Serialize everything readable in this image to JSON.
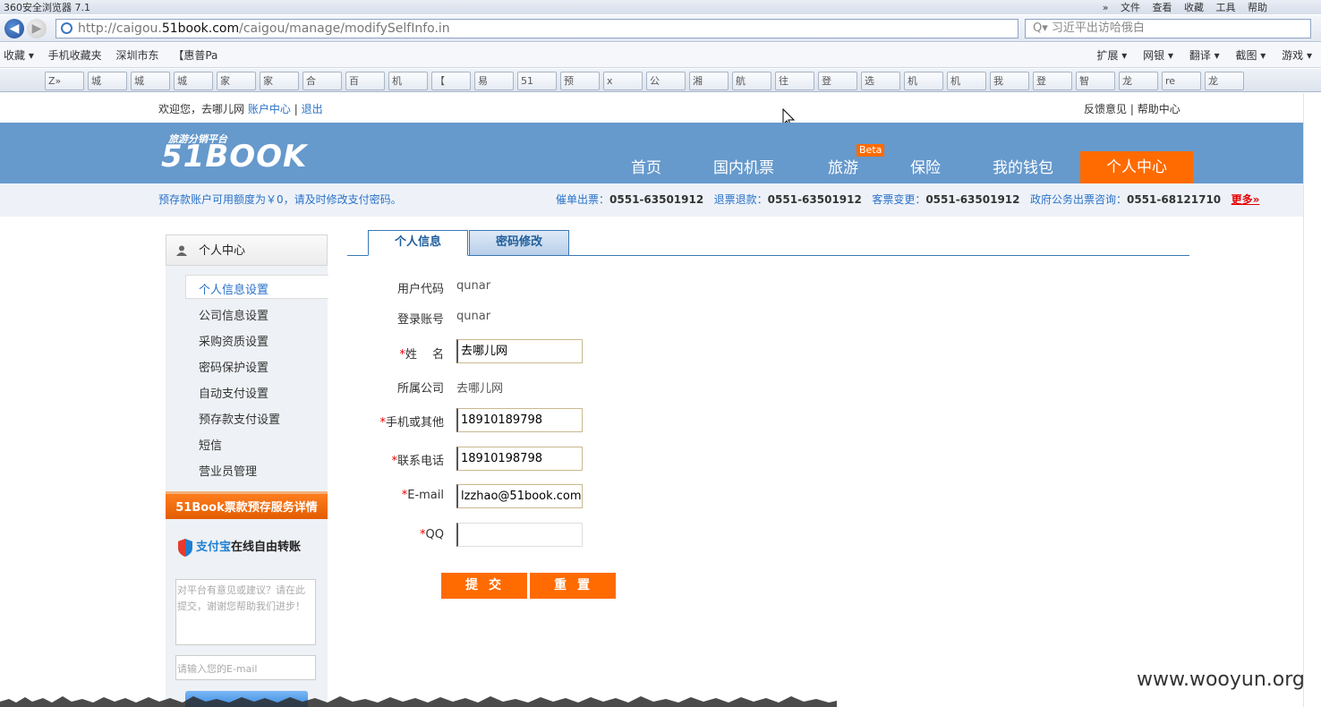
{
  "browser": {
    "title": "360安全浏览器 7.1",
    "menu": [
      "»",
      "文件",
      "查看",
      "收藏",
      "工具",
      "帮助"
    ],
    "url_prefix": "http://caigou.",
    "url_domain": "51book.com",
    "url_path": "/caigou/manage/modifySelfInfo.in",
    "search_text": "习近平出访哈俄白",
    "favorites_left": [
      "收藏 ▾",
      "手机收藏夹",
      "深圳市东",
      "【惠普Pa"
    ],
    "favorites_right": [
      "扩展 ▾",
      "网银 ▾",
      "翻译 ▾",
      "截图 ▾",
      "游戏 ▾"
    ],
    "tabs": [
      "Z»",
      "城",
      "城",
      "城",
      "家",
      "家",
      "合",
      "百",
      "机",
      "【",
      "易",
      "51",
      "预",
      "x",
      "公",
      "湘",
      "航",
      "往",
      "登",
      "选",
      "机",
      "机",
      "我",
      "登",
      "智",
      "龙",
      "re",
      "龙"
    ]
  },
  "topbar": {
    "welcome": "欢迎您，去哪儿网",
    "account_center": "账户中心",
    "separator": "|",
    "logout": "退出",
    "feedback": "反馈意见",
    "help": "帮助中心"
  },
  "header": {
    "logo_small": "旅游分销平台",
    "logo_big": "51BOOK",
    "beta": "Beta",
    "nav": [
      "首页",
      "国内机票",
      "旅游",
      "保险",
      "我的钱包"
    ],
    "nav_active": "个人中心"
  },
  "infobar": {
    "notice": "预存款账户可用额度为￥0，请及时修改支付密码。",
    "label1": "催单出票：",
    "phone1": "0551-63501912",
    "label2": "退票退款：",
    "phone2": "0551-63501912",
    "label3": "客票变更：",
    "phone3": "0551-63501912",
    "label4": "政府公务出票咨询：",
    "phone4": "0551-68121710",
    "more": "更多»"
  },
  "sidebar": {
    "title": "个人中心",
    "items": [
      "个人信息设置",
      "公司信息设置",
      "采购资质设置",
      "密码保护设置",
      "自动支付设置",
      "预存款支付设置",
      "短信",
      "营业员管理"
    ],
    "promo": "51Book票款预存服务详情",
    "alipay_blue": "支付宝",
    "alipay_rest": "在线自由转账",
    "feedback_placeholder": "对平台有意见或建议？请在此提交，谢谢您帮助我们进步！",
    "email_placeholder": "请输入您的E-mail"
  },
  "tabs": {
    "info": "个人信息",
    "password": "密码修改"
  },
  "form": {
    "user_code_label": "用户代码",
    "user_code": "qunar",
    "login_label": "登录账号",
    "login": "qunar",
    "name_label": "姓　 名",
    "name": "去哪儿网",
    "company_label": "所属公司",
    "company": "去哪儿网",
    "mobile_label": "手机或其他",
    "mobile": "18910189798",
    "phone_label": "联系电话",
    "phone": "18910198798",
    "email_label": "E-mail",
    "email": "lzzhao@51book.com",
    "qq_label": "QQ",
    "qq": "",
    "required": "*",
    "submit": "提交",
    "reset": "重置"
  },
  "watermark": "www.wooyun.org",
  "colors": {
    "header_blue": "#6699cc",
    "accent_orange": "#ff6b00",
    "link_blue": "#2a72c9"
  }
}
